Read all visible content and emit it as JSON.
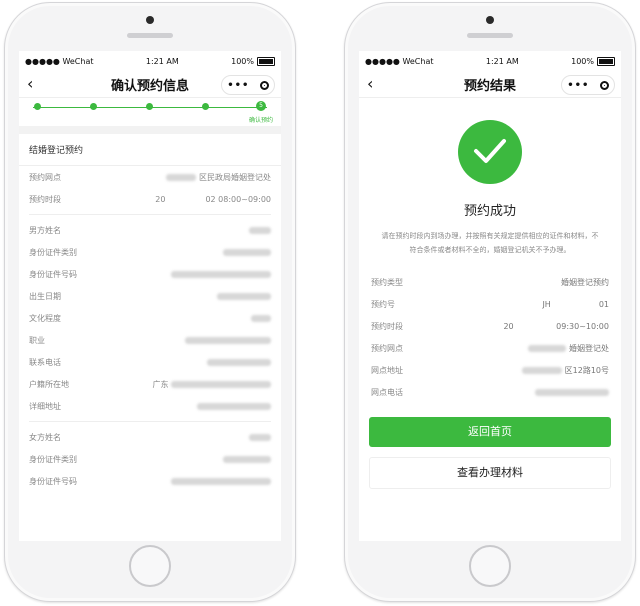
{
  "status": {
    "signal": "●●●●● WeChat",
    "time": "1:21 AM",
    "battery": "100%"
  },
  "left": {
    "title": "确认预约信息",
    "steps": [
      "",
      "",
      "",
      "",
      "确认预约"
    ],
    "step_last_marker": "5",
    "section_title": "结婚登记预约",
    "booking": [
      {
        "label": "预约网点",
        "value": "区民政局婚姻登记处"
      },
      {
        "label": "预约时段",
        "value": "20     02 08:00~09:00"
      }
    ],
    "male_fields": [
      "男方姓名",
      "身份证件类别",
      "身份证件号码",
      "出生日期",
      "文化程度",
      "职业",
      "联系电话",
      "户籍所在地",
      "详细地址"
    ],
    "household_prefix": "广东",
    "female_fields": [
      "女方姓名",
      "身份证件类别",
      "身份证件号码"
    ]
  },
  "right": {
    "title": "预约结果",
    "success_title": "预约成功",
    "notice": "请在预约时段内到场办理，并按照有关规定提供相应的证件和材料，不符合条件或者材料不全的，婚姻登记机关不予办理。",
    "rows": [
      {
        "label": "预约类型",
        "value": "婚姻登记预约"
      },
      {
        "label": "预约号",
        "value": "JH      01"
      },
      {
        "label": "预约时段",
        "value": "20      09:30~10:00"
      },
      {
        "label": "预约网点",
        "value": "婚姻登记处"
      },
      {
        "label": "网点地址",
        "value": "区12路10号"
      },
      {
        "label": "网点电话",
        "value": ""
      }
    ],
    "primary_button": "返回首页",
    "secondary_button": "查看办理材料"
  },
  "colors": {
    "accent": "#3cb93f"
  }
}
